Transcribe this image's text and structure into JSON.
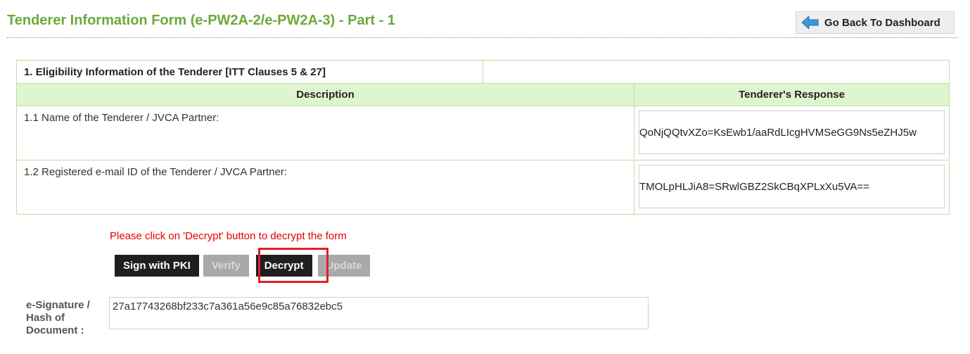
{
  "header": {
    "title": "Tenderer Information Form (e-PW2A-2/e-PW2A-3) - Part - 1",
    "back_button": "Go Back To Dashboard",
    "back_icon": "left-arrow-icon"
  },
  "table": {
    "section_title": "1. Eligibility Information of the Tenderer [ITT Clauses 5 & 27]",
    "columns": [
      "Description",
      "Tenderer's Response"
    ],
    "rows": [
      {
        "description": "1.1 Name of the Tenderer / JVCA Partner:",
        "response": "QoNjQQtvXZo=KsEwb1/aaRdLIcgHVMSeGG9Ns5eZHJ5w"
      },
      {
        "description": "1.2 Registered e-mail ID of the Tenderer / JVCA Partner:",
        "response": "TMOLpHLJiA8=SRwlGBZ2SkCBqXPLxXu5VA=="
      }
    ]
  },
  "actions": {
    "hint": "Please click on 'Decrypt' button to decrypt the form",
    "sign_label": "Sign with PKI",
    "verify_label": "Verify",
    "decrypt_label": "Decrypt",
    "update_label": "Update"
  },
  "signature": {
    "label": "e-Signature / Hash of Document :",
    "value": "27a17743268bf233c7a361a56e9c85a76832ebc5"
  },
  "colors": {
    "title_green": "#6aaa3a",
    "header_bg": "#dff5cf",
    "hint_red": "#e00000",
    "highlight_red": "#e0202a"
  }
}
